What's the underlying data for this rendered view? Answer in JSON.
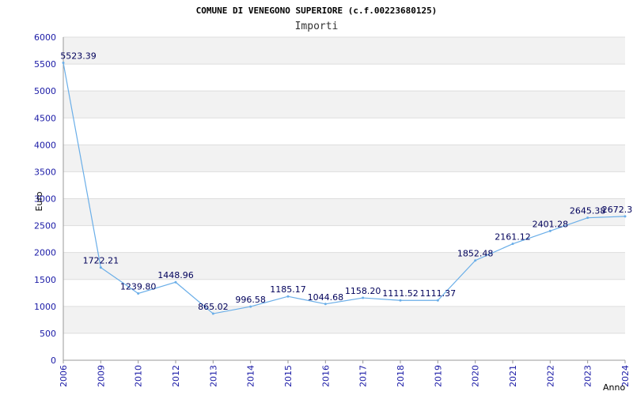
{
  "chart_data": {
    "type": "line",
    "title": "COMUNE DI VENEGONO SUPERIORE (c.f.00223680125)",
    "subtitle": "Importi",
    "xlabel": "Anno",
    "ylabel": "Euro",
    "categories": [
      "2006",
      "2009",
      "2010",
      "2012",
      "2013",
      "2014",
      "2015",
      "2016",
      "2017",
      "2018",
      "2019",
      "2020",
      "2021",
      "2022",
      "2023",
      "2024"
    ],
    "series": [
      {
        "values": [
          5523.39,
          1722.21,
          1239.8,
          1448.96,
          865.02,
          996.58,
          1185.17,
          1044.68,
          1158.2,
          1111.52,
          1111.37,
          1852.48,
          2161.12,
          2401.28,
          2645.38,
          2672.3
        ],
        "labels": [
          "5523.39",
          "1722.21",
          "1239.80",
          "1448.96",
          "865.02",
          "996.58",
          "1185.17",
          "1044.68",
          "1158.20",
          "1111.52",
          "1111.37",
          "1852.48",
          "2161.12",
          "2401.28",
          "2645.38",
          "2672.3"
        ]
      }
    ],
    "ylim": [
      0,
      6000
    ],
    "yticks": [
      0,
      500,
      1000,
      1500,
      2000,
      2500,
      3000,
      3500,
      4000,
      4500,
      5000,
      5500,
      6000
    ],
    "grid": true,
    "colors": {
      "line": "#6aaee8",
      "band": "#f2f2f2",
      "grid": "#dddddd",
      "tick": "#1a1aa6",
      "label": "#00005a"
    }
  }
}
